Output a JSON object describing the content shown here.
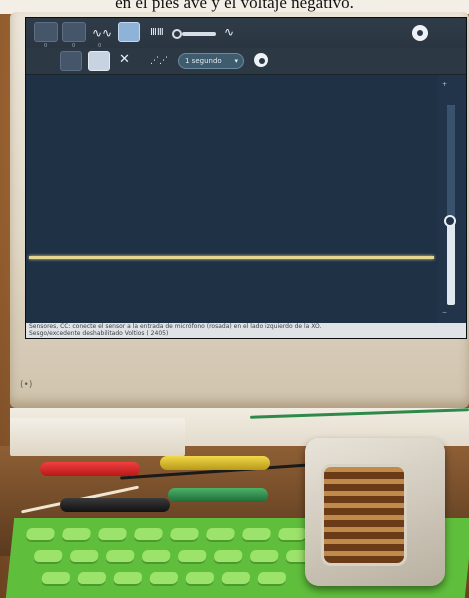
{
  "caption": {
    "text": "en el pies ave y el voltaje negativo."
  },
  "app": {
    "toolbar": {
      "row1_labels": [
        "0",
        "0",
        "0"
      ],
      "time_label": "1 segundo",
      "wave_icon": "sine-wave-icon",
      "stop_icon": "stop-icon"
    },
    "vscale": {
      "top_mark": "+",
      "bottom_mark": "−",
      "level_fraction": 0.42
    },
    "status": {
      "line1": "Sensores, CC: conecte el sensor a la entrada de micrófono (rosada) en el lado izquierdo de la XO.",
      "line2": "Sesgo/excedente deshabilitado Voltios        ( 2405)"
    }
  },
  "colors": {
    "screen_bg": "#1f3145",
    "trace": "#e6d691",
    "keyboard": "#5fbe3c",
    "bezel": "#e7e0d2"
  }
}
